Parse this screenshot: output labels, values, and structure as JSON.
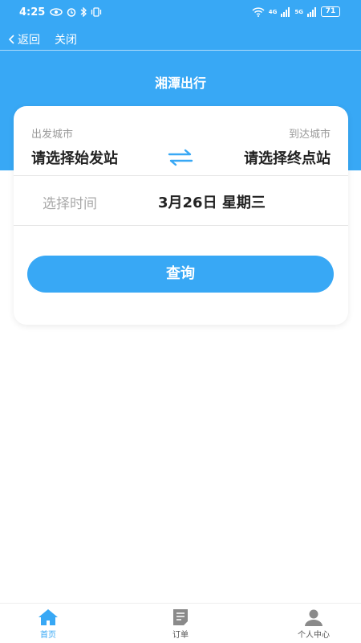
{
  "status": {
    "time": "4:25",
    "battery": "71",
    "net_1": "4G",
    "net_2": "5G"
  },
  "nav": {
    "back_label": "返回",
    "close_label": "关闭"
  },
  "page": {
    "title": "湘潭出行"
  },
  "form": {
    "from_label": "出发城市",
    "to_label": "到达城市",
    "from_station": "请选择始发站",
    "to_station": "请选择终点站",
    "time_label": "选择时间",
    "date": "3月26日 星期三",
    "query_label": "查询"
  },
  "tabs": [
    {
      "label": "首页",
      "active": true,
      "icon": "home-icon"
    },
    {
      "label": "订单",
      "active": false,
      "icon": "order-icon"
    },
    {
      "label": "个人中心",
      "active": false,
      "icon": "user-icon"
    }
  ],
  "colors": {
    "primary": "#38A8F5",
    "text": "#222222",
    "muted": "#9a9a9a"
  }
}
